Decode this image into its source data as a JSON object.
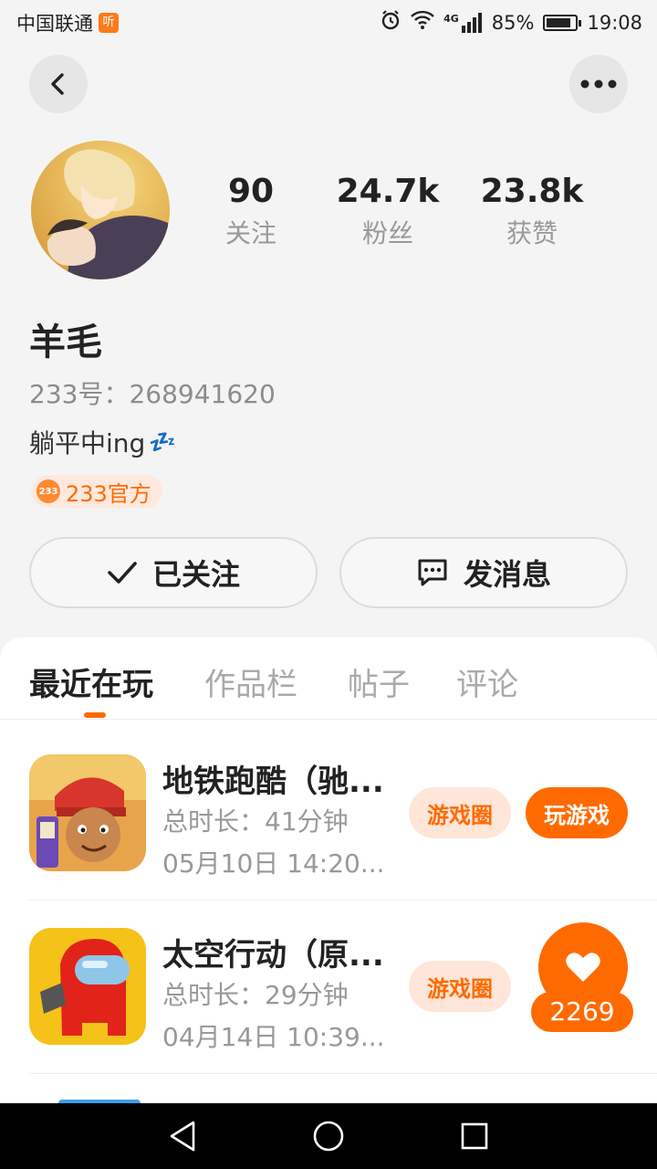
{
  "status_bar": {
    "carrier": "中国联通",
    "carrier_tag": "听",
    "network": "4G",
    "battery": "85%",
    "battery_level": 0.85,
    "time": "19:08"
  },
  "nav": {
    "back_icon": "chevron-left-icon",
    "more_icon": "more-horizontal-icon"
  },
  "profile": {
    "name": "羊毛",
    "uid": "233号：268941620",
    "bio": "躺平中ing",
    "bio_emoji": "💤",
    "badge_label": "233官方",
    "badge_icon_text": "233",
    "stats": [
      {
        "value": "90",
        "label": "关注"
      },
      {
        "value": "24.7k",
        "label": "粉丝"
      },
      {
        "value": "23.8k",
        "label": "获赞"
      }
    ],
    "follow_label": "已关注",
    "message_label": "发消息"
  },
  "tabs": [
    {
      "label": "最近在玩",
      "active": true
    },
    {
      "label": "作品栏",
      "active": false
    },
    {
      "label": "帖子",
      "active": false
    },
    {
      "label": "评论",
      "active": false
    }
  ],
  "games": [
    {
      "title": "地铁跑酷（驰...",
      "duration": "总时长：41分钟",
      "last_played": "05月10日 14:20...",
      "circle_label": "游戏圈",
      "play_label": "玩游戏"
    },
    {
      "title": "太空行动（原...",
      "duration": "总时长：29分钟",
      "last_played": "04月14日 10:39...",
      "circle_label": "游戏圈"
    }
  ],
  "like_float": {
    "count": "2269"
  },
  "colors": {
    "accent": "#ff6a00",
    "accent_soft": "#ffe6d8",
    "background": "#f4f4f4"
  }
}
